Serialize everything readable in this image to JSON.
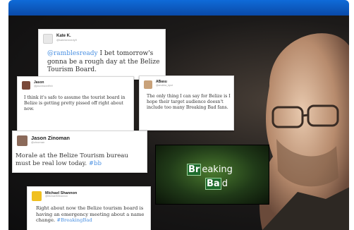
{
  "colors": {
    "topbar": "#0a5bc4",
    "mention": "#4a90e2",
    "bb_green": "#1e6b2c"
  },
  "tweets": [
    {
      "name": "Kate K.",
      "handle": "@katekennedy9",
      "mention": "@ramblesready",
      "text": " I bet tomorrow's gonna be a rough day at the Belize Tourism Board."
    },
    {
      "name": "Jason",
      "handle": "@jasonswordfish",
      "text": "I think it's safe to assume the tourist board in Belize is getting pretty pissed off right about now."
    },
    {
      "name": "ABasu",
      "handle": "@anubba_kpot",
      "text": "The only thing I can say for Belize is I hope their target audience doesn't include too many Breaking Bad fans."
    },
    {
      "name": "Jason Zinoman",
      "handle": "@zinoman",
      "text": "Morale at the Belize Tourism bureau must be real low today. ",
      "hashtag": "#bb"
    },
    {
      "name": "Michael Shannon",
      "handle": "@MichaelSShannon",
      "text": "Right about now the Belize tourism board is having an emergency meeting about a name change. ",
      "hashtag": "#BreakingBad"
    }
  ],
  "logo": {
    "line1_el": "Br",
    "line1_rest": "eaking",
    "line2_el": "Ba",
    "line2_rest": "d"
  }
}
